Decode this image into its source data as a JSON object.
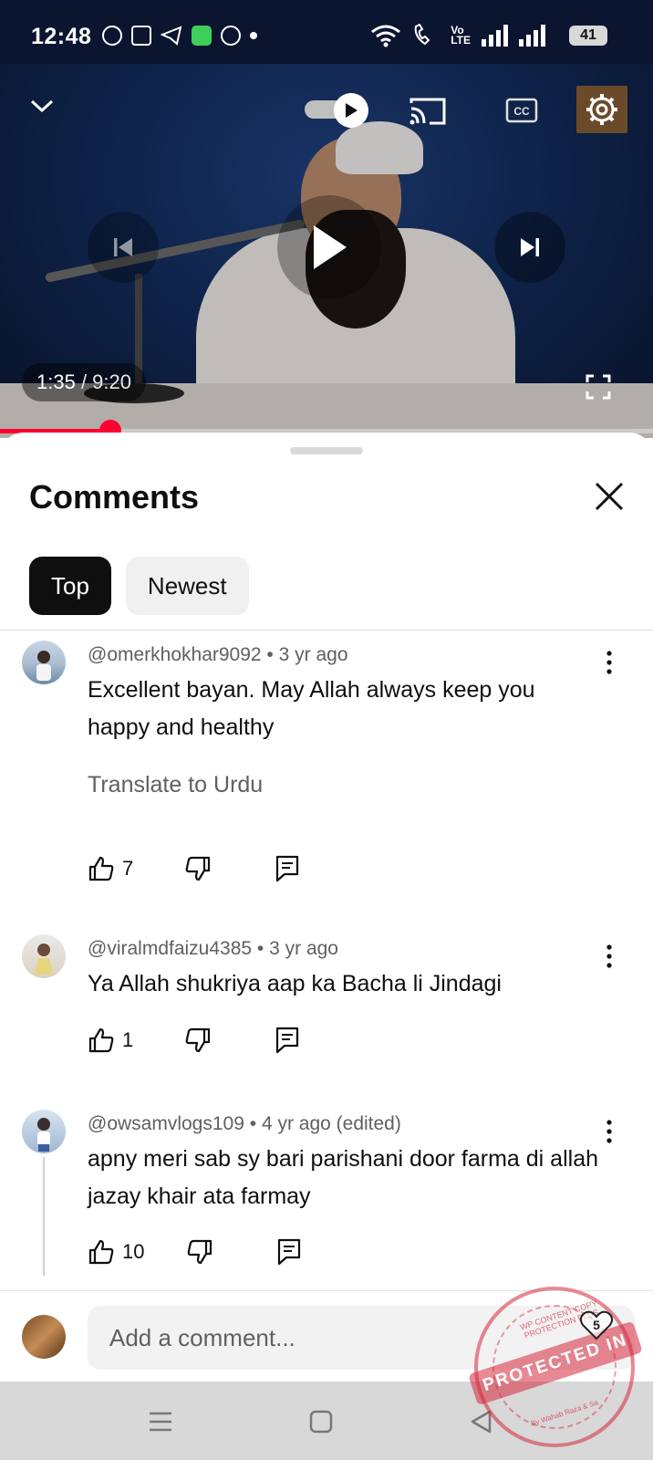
{
  "status_bar": {
    "time": "12:48",
    "network_label": "Vo\nLTE",
    "battery": "41"
  },
  "player": {
    "current_time": "1:35",
    "duration": "9:20",
    "progress_fraction": 0.169
  },
  "comments_panel": {
    "title": "Comments",
    "tabs": [
      {
        "label": "Top",
        "active": true
      },
      {
        "label": "Newest",
        "active": false
      }
    ],
    "comments": [
      {
        "author": "@omerkhokhar9092",
        "age": "3 yr ago",
        "text": "Excellent bayan. May Allah always keep you happy and healthy",
        "translate": "Translate to Urdu",
        "likes": "7"
      },
      {
        "author": "@viralmdfaizu4385",
        "age": "3 yr ago",
        "text": "Ya Allah shukriya aap ka Bacha li Jindagi",
        "likes": "1"
      },
      {
        "author": "@owsamvlogs109",
        "age": "4 yr ago (edited)",
        "text": "apny meri sab sy bari parishani door farma di allah jazay khair ata farmay",
        "likes": "10"
      }
    ],
    "composer_placeholder": "Add a comment..."
  },
  "watermark": {
    "band_text": "PROTECTED IN",
    "ring_top": "WP CONTENT COPY PROTECTION PLUS",
    "ring_bottom": "By Wahab Raza & Sa",
    "heart_number": "5"
  },
  "colors": {
    "accent_red": "#ff0033",
    "chip_active_bg": "#0f0f0f",
    "chip_bg": "#f0f0f0",
    "meta_text": "#606060"
  }
}
